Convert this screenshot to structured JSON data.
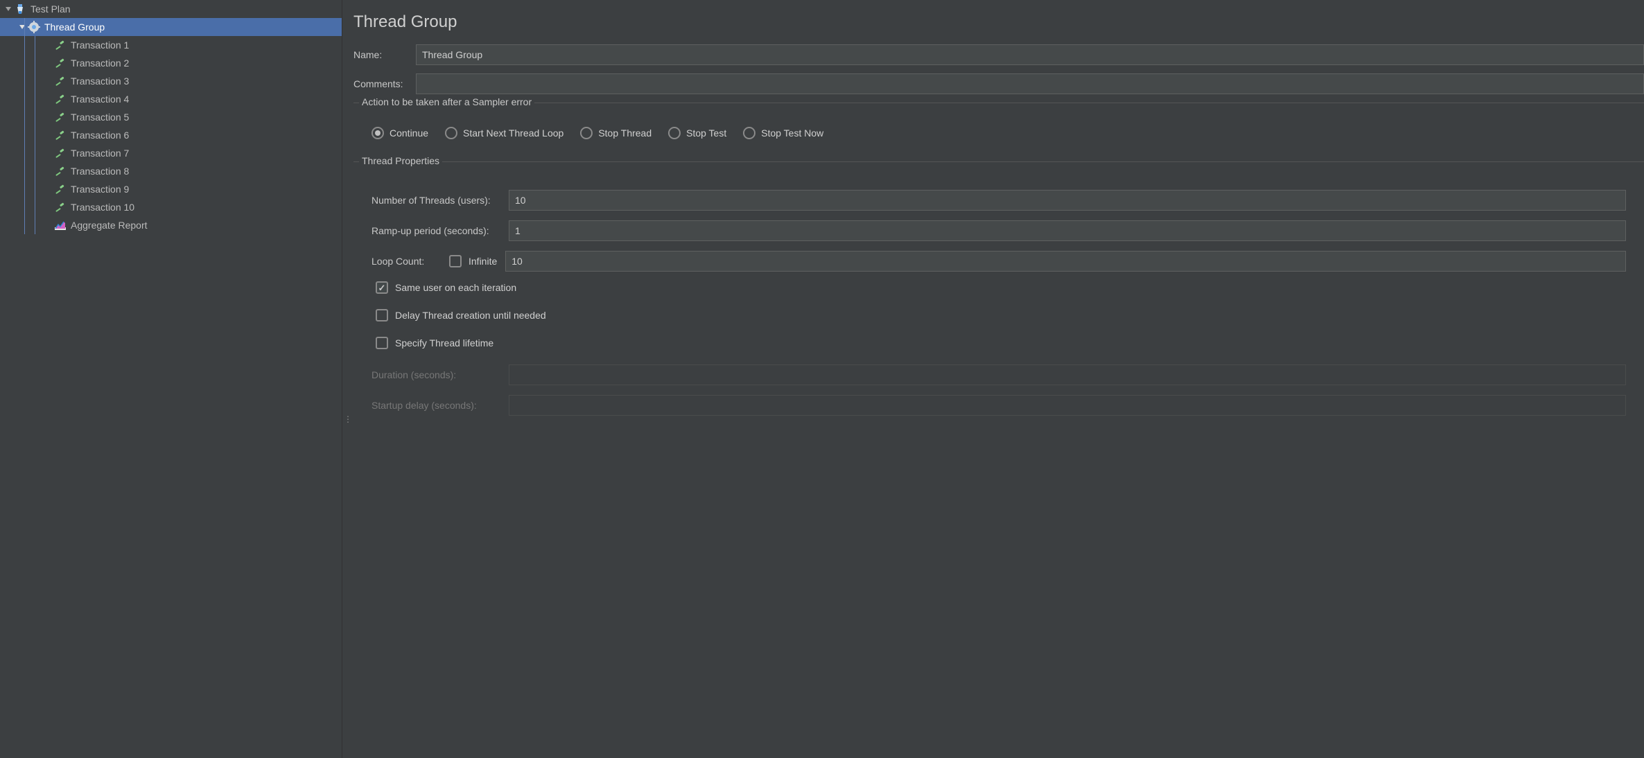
{
  "tree": {
    "testPlan": "Test Plan",
    "threadGroup": "Thread Group",
    "transactions": [
      "Transaction 1",
      "Transaction 2",
      "Transaction 3",
      "Transaction 4",
      "Transaction 5",
      "Transaction 6",
      "Transaction 7",
      "Transaction 8",
      "Transaction 9",
      "Transaction 10"
    ],
    "aggregateReport": "Aggregate Report"
  },
  "panel": {
    "title": "Thread Group",
    "nameLabel": "Name:",
    "nameValue": "Thread Group",
    "commentsLabel": "Comments:",
    "commentsValue": "",
    "samplerErrorGroup": {
      "legend": "Action to be taken after a Sampler error",
      "continue": "Continue",
      "startNextLoop": "Start Next Thread Loop",
      "stopThread": "Stop Thread",
      "stopTest": "Stop Test",
      "stopTestNow": "Stop Test Now"
    },
    "threadProps": {
      "legend": "Thread Properties",
      "numThreadsLabel": "Number of Threads (users):",
      "numThreadsValue": "10",
      "rampUpLabel": "Ramp-up period (seconds):",
      "rampUpValue": "1",
      "loopCountLabel": "Loop Count:",
      "infiniteLabel": "Infinite",
      "loopCountValue": "10",
      "sameUserLabel": "Same user on each iteration",
      "delayCreationLabel": "Delay Thread creation until needed",
      "specifyLifetimeLabel": "Specify Thread lifetime",
      "durationLabel": "Duration (seconds):",
      "durationValue": "",
      "startupDelayLabel": "Startup delay (seconds):",
      "startupDelayValue": ""
    }
  }
}
